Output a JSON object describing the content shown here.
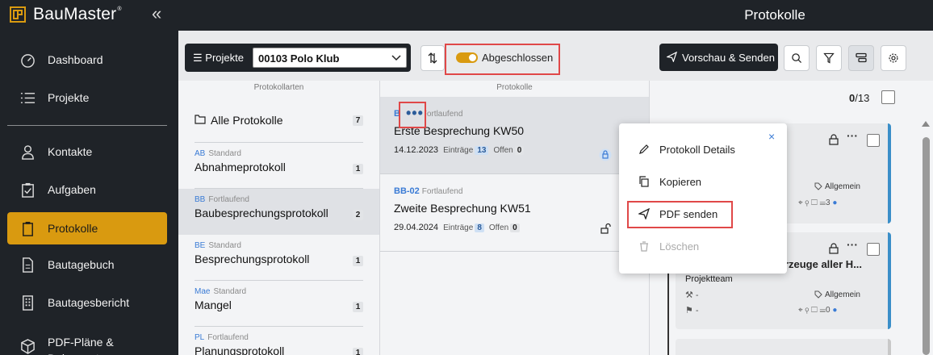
{
  "app": {
    "name": "BauMaster",
    "trademark": "®",
    "collapse": "«",
    "page_title": "Protokolle"
  },
  "sidebar": {
    "items": [
      {
        "label": "Dashboard",
        "icon": "dashboard-icon"
      },
      {
        "label": "Projekte",
        "icon": "list-icon"
      },
      {
        "label": "Kontakte",
        "icon": "person-icon"
      },
      {
        "label": "Aufgaben",
        "icon": "clipboard-check-icon"
      },
      {
        "label": "Protokolle",
        "icon": "clipboard-icon",
        "active": true
      },
      {
        "label": "Bautagebuch",
        "icon": "document-icon"
      },
      {
        "label": "Bautagesbericht",
        "icon": "building-icon"
      },
      {
        "label": "PDF-Pläne & Dokumente",
        "icon": "cube-icon"
      }
    ]
  },
  "toolbar": {
    "projects_label": "Projekte",
    "project_value": "00103 Polo Klub",
    "toggle_label": "Abgeschlossen",
    "toggle_on": true,
    "preview_label": "Vorschau & Senden"
  },
  "columns": {
    "types_header": "Protokollarten",
    "protocols_header": "Protokolle"
  },
  "types": {
    "all": {
      "label": "Alle Protokolle",
      "count": "7"
    },
    "items": [
      {
        "code": "AB",
        "kind": "Standard",
        "name": "Abnahmeprotokoll",
        "count": "1"
      },
      {
        "code": "BB",
        "kind": "Fortlaufend",
        "name": "Baubesprechungsprotokoll",
        "count": "2"
      },
      {
        "code": "BE",
        "kind": "Standard",
        "name": "Besprechungsprotokoll",
        "count": "1"
      },
      {
        "code": "Mae",
        "kind": "Standard",
        "name": "Mangel",
        "count": "1"
      },
      {
        "code": "PL",
        "kind": "Fortlaufend",
        "name": "Planungsprotokoll",
        "count": "1"
      }
    ]
  },
  "protocols": [
    {
      "id": "BB-01",
      "kind": "Fortlaufend",
      "name": "Erste Besprechung KW50",
      "date": "14.12.2023",
      "entries_label": "Einträge",
      "entries": "13",
      "open_label": "Offen",
      "open": "0"
    },
    {
      "id": "BB-02",
      "kind": "Fortlaufend",
      "name": "Zweite Besprechung KW51",
      "date": "29.04.2024",
      "entries_label": "Einträge",
      "entries": "8",
      "open_label": "Offen",
      "open": "0"
    }
  ],
  "entries_panel": {
    "selected": "0",
    "total": "/13",
    "card1": {
      "tag": "Allgemein",
      "task_count": "3"
    },
    "card2": {
      "title": "hrzeuge aller H...",
      "team": "Projektteam",
      "row1": "-",
      "row2": "-",
      "tag": "Allgemein",
      "task_count": "0"
    }
  },
  "popup": {
    "items": [
      {
        "label": "Protokoll Details",
        "icon": "pencil-icon"
      },
      {
        "label": "Kopieren",
        "icon": "copy-icon"
      },
      {
        "label": "PDF senden",
        "icon": "send-icon"
      },
      {
        "label": "Löschen",
        "icon": "trash-icon",
        "disabled": true
      }
    ],
    "close": "×"
  },
  "colors": {
    "accent": "#d99a10",
    "dark": "#1f2328",
    "link": "#3a7bd5",
    "highlight": "#e04848"
  }
}
